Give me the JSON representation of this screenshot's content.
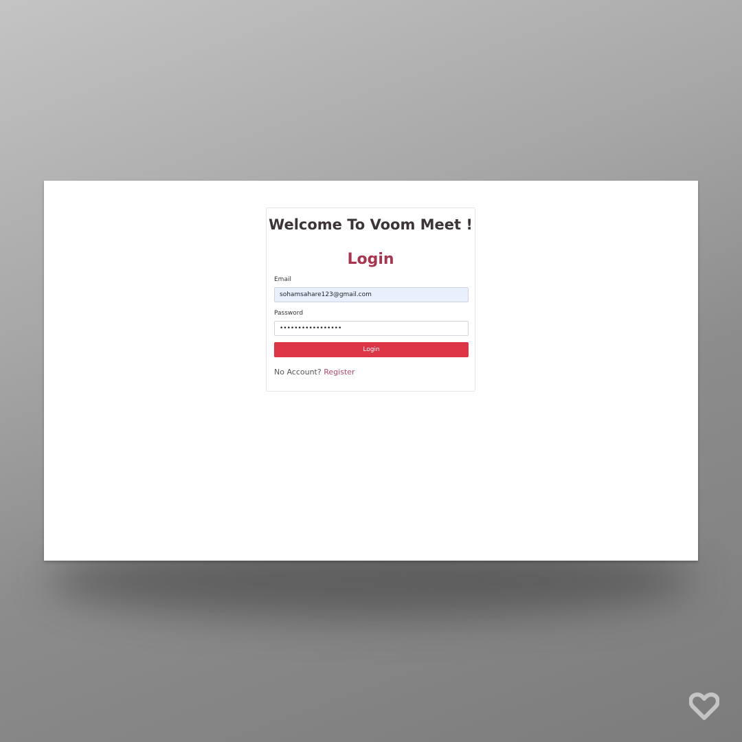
{
  "welcome": {
    "title": "Welcome To Voom Meet !"
  },
  "form": {
    "heading": "Login",
    "email_label": "Email",
    "email_value": "sohamsahare123@gmail.com",
    "password_label": "Password",
    "password_value": "•••••••••••••••••",
    "submit_label": "Login"
  },
  "footer": {
    "prompt": "No Account?",
    "register_link": "Register"
  },
  "colors": {
    "accent": "#dc3545",
    "heading": "#a8344f",
    "link": "#b04a6a",
    "email_autofill_bg": "#e8f0fe"
  },
  "icons": {
    "watermark": "heart-icon"
  }
}
